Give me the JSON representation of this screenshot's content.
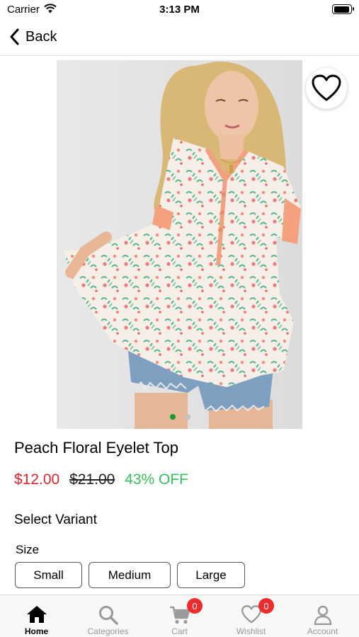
{
  "status_bar": {
    "carrier": "Carrier",
    "time": "3:13 PM"
  },
  "nav": {
    "back_label": "Back"
  },
  "product": {
    "title": "Peach Floral Eyelet Top",
    "sale_price": "$12.00",
    "original_price": "$21.00",
    "discount": "43% OFF",
    "image_icon": "product-photo-floral-top",
    "carousel_pages": 2,
    "carousel_active": 1
  },
  "variants": {
    "heading": "Select Variant",
    "size_label": "Size",
    "sizes": [
      "Small",
      "Medium",
      "Large"
    ]
  },
  "tabs": [
    {
      "label": "Home",
      "icon": "home-icon",
      "active": true
    },
    {
      "label": "Categories",
      "icon": "search-icon"
    },
    {
      "label": "Cart",
      "icon": "cart-icon",
      "badge": "0"
    },
    {
      "label": "Wishlist",
      "icon": "heart-icon",
      "badge": "0"
    },
    {
      "label": "Account",
      "icon": "person-icon"
    }
  ],
  "colors": {
    "sale": "#e3222b",
    "discount": "#33c25a",
    "badge": "#ef2b2b",
    "active_dot": "#1a9a2e"
  }
}
